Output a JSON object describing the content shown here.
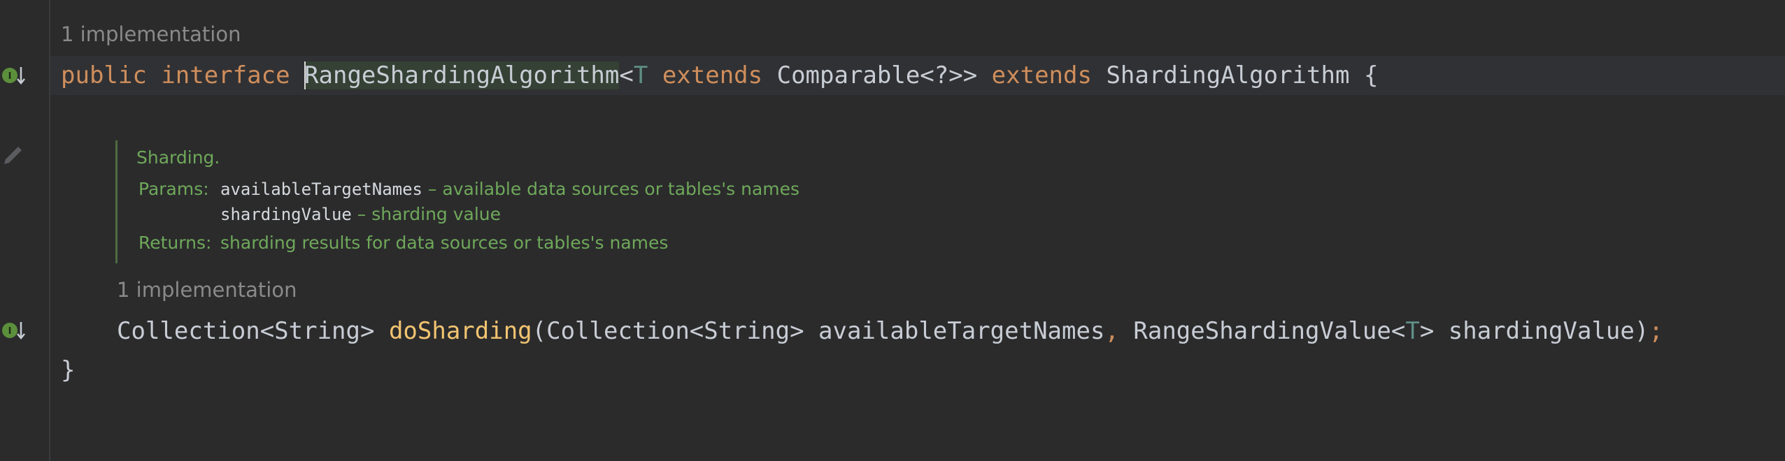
{
  "editor": {
    "interface_hint": "1 implementation",
    "method_hint": "1 implementation",
    "line1": {
      "kw_public": "public",
      "kw_interface": "interface",
      "name_selected": "RangeShardingAlgorithm",
      "lt": "<",
      "type_param": "T",
      "kw_extends1": "extends",
      "comparable": "Comparable<?>>",
      "kw_extends2": "extends",
      "super_type": "ShardingAlgorithm",
      "open_brace": "{"
    },
    "doc": {
      "summary": "Sharding.",
      "params_label": "Params:",
      "param1_name": "availableTargetNames",
      "param1_desc": " – available data sources or tables's names",
      "param2_name": "shardingValue",
      "param2_desc": " – sharding value",
      "returns_label": "Returns:",
      "returns_desc": "sharding results for data sources or tables's names"
    },
    "method_line": {
      "return_type": "Collection<String> ",
      "method_name": "doSharding",
      "params_a": "(Collection<String> availableTargetNames",
      "comma": ",",
      "params_b": " RangeShardingValue<",
      "type_param": "T",
      "params_c": "> shardingValue)",
      "semicolon": ";"
    },
    "close_brace": "}"
  },
  "gutter": {
    "icons": [
      "implemented-interface-icon",
      "edit-doc-icon",
      "implemented-method-icon"
    ]
  },
  "colors": {
    "background": "#2b2b2c",
    "keyword": "#cf8e5c",
    "method": "#f2c471",
    "doc_text": "#6fa85a",
    "hint": "#8a8a8a"
  }
}
